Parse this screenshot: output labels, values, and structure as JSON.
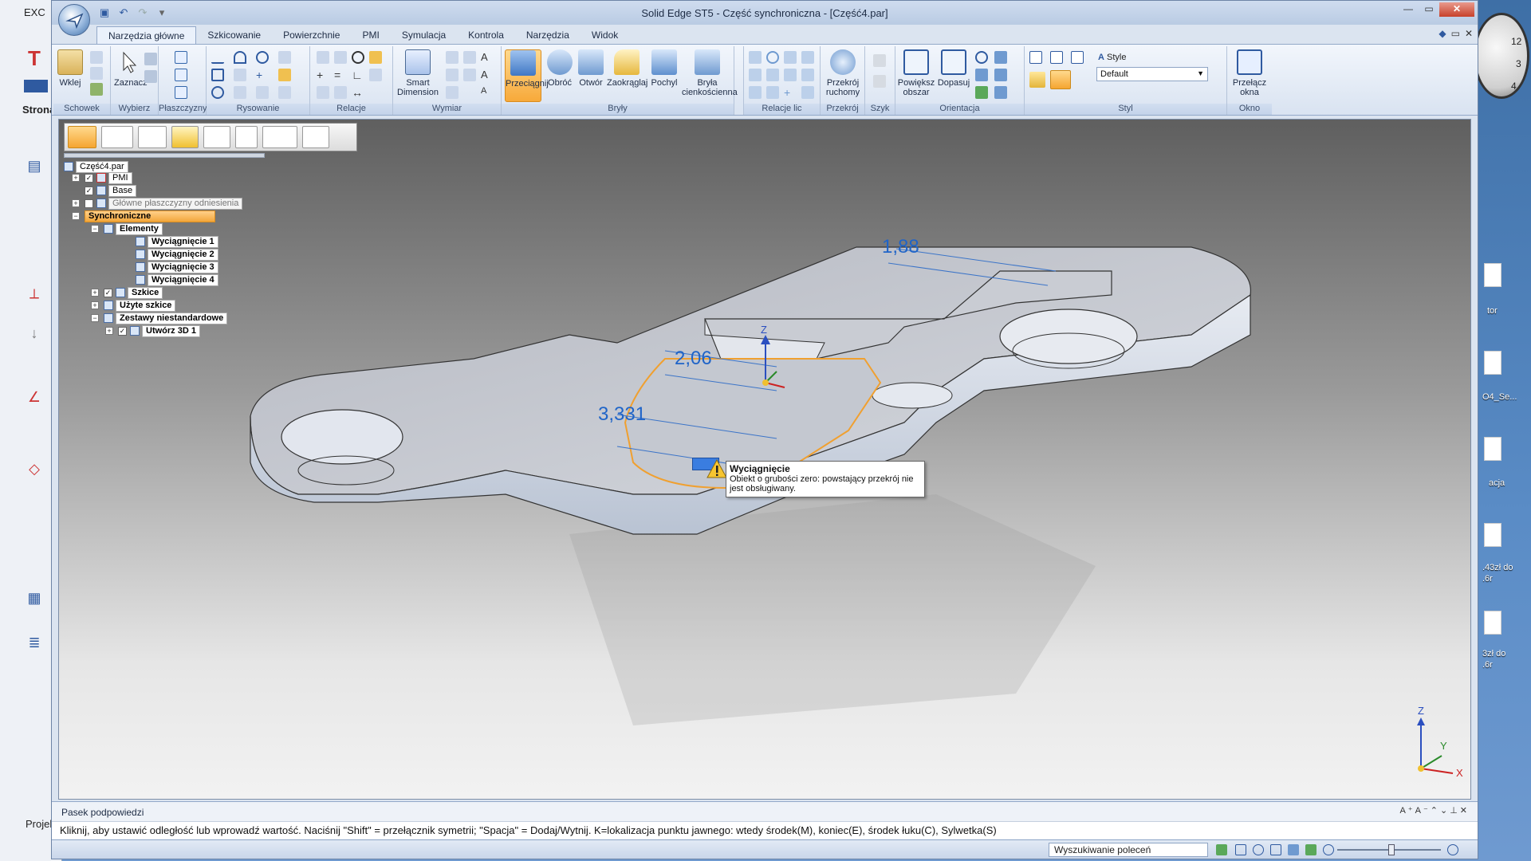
{
  "window": {
    "title": "Solid Edge ST5 - Część synchroniczna - [Część4.par]"
  },
  "background_app": {
    "title_fragment": "EXC",
    "side_label": "Strona",
    "bottom_label": "Projek",
    "desktop_labels": [
      "tor",
      "O4_Se...",
      "acja",
      ".43zł do",
      ".6r",
      "3zł do",
      ".6r"
    ]
  },
  "ribbon": {
    "tabs": [
      "Narzędzia główne",
      "Szkicowanie",
      "Powierzchnie",
      "PMI",
      "Symulacja",
      "Kontrola",
      "Narzędzia",
      "Widok"
    ],
    "active_tab": "Narzędzia główne",
    "groups": {
      "schowek": "Schowek",
      "wybierz": "Wybierz",
      "plaszczyzny": "Płaszczyzny",
      "rysowanie": "Rysowanie",
      "relacje": "Relacje",
      "wymiar": "Wymiar",
      "bryly": "Bryły",
      "relacje_lic": "Relacje lic",
      "przekroj": "Przekrój",
      "szyk": "Szyk",
      "orientacja": "Orientacja",
      "styl": "Styl",
      "okno": "Okno"
    },
    "buttons": {
      "wklej": "Wklej",
      "zaznacz": "Zaznacz",
      "smart_dimension_1": "Smart",
      "smart_dimension_2": "Dimension",
      "przeciagnij": "Przeciągnij",
      "obroc": "Obróć",
      "otwor": "Otwór",
      "zaokraglaj": "Zaokrąglaj",
      "pochyl": "Pochyl",
      "bryla_1": "Bryła",
      "bryla_2": "cienkościenna",
      "przekroj_1": "Przekrój",
      "przekroj_2": "ruchomy",
      "powieksz_1": "Powiększ",
      "powieksz_2": "obszar",
      "dopasuj": "Dopasuj",
      "przelacz_1": "Przełącz",
      "przelacz_2": "okna"
    },
    "style": {
      "label": "Style",
      "value": "Default"
    }
  },
  "tree": {
    "root": "Część4.par",
    "pmi": "PMI",
    "base": "Base",
    "planes": "Główne płaszczyzny odniesienia",
    "sync": "Synchroniczne",
    "elementy": "Elementy",
    "w1": "Wyciągnięcie 1",
    "w2": "Wyciągnięcie 2",
    "w3": "Wyciągnięcie 3",
    "w4": "Wyciągnięcie 4",
    "szkice": "Szkice",
    "uzyte": "Użyte szkice",
    "zestawy": "Zestawy niestandardowe",
    "utworz": "Utwórz 3D 1"
  },
  "viewport": {
    "dims": [
      "1,88",
      "2,06",
      "3,331"
    ],
    "axis_labels": {
      "x": "X",
      "y": "Y",
      "z": "Z"
    },
    "tooltip": {
      "title": "Wyciągnięcie",
      "body": "Obiekt o grubości zero: powstający przekrój nie jest obsługiwany."
    }
  },
  "prompt": {
    "title": "Pasek podpowiedzi",
    "text": "Kliknij, aby ustawić odległość lub wprowadź wartość.  Naciśnij \"Shift\" = przełącznik symetrii; \"Spacja\" = Dodaj/Wytnij. K=lokalizacja punktu jawnego: wtedy środek(M), koniec(E), środek łuku(C), Sylwetka(S)"
  },
  "status": {
    "search": "Wyszukiwanie poleceń"
  },
  "colors": {
    "accent": "#f7a93a",
    "dimension": "#1f64c8",
    "ribbon": "#d9e3f1"
  }
}
